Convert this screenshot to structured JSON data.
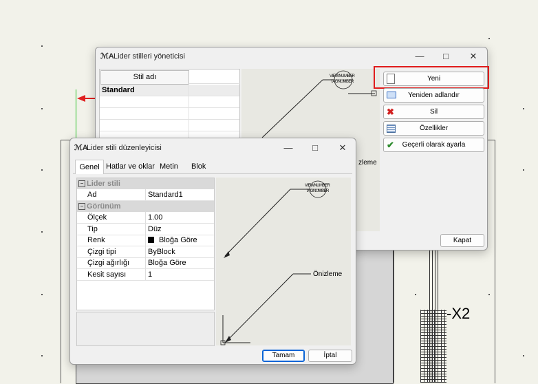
{
  "cad": {
    "label_x2": "-X2",
    "preview_label_top": "VIEWNUMBER\nTAGNUMBER",
    "preview_note_partial": "zleme"
  },
  "manager": {
    "title": "Lider stilleri yöneticisi",
    "table": {
      "column_header": "Stil adı",
      "rows": [
        "Standard"
      ]
    },
    "buttons": {
      "new": "Yeni",
      "rename": "Yeniden adlandır",
      "delete": "Sil",
      "properties": "Özellikler",
      "set_current": "Geçerli olarak ayarla",
      "close": "Kapat"
    }
  },
  "editor": {
    "title": "Lider stili düzenleyicisi",
    "tabs": [
      "Genel",
      "Hatlar ve oklar",
      "Metin",
      "Blok"
    ],
    "groups": [
      {
        "name": "Lider stili",
        "props": [
          {
            "label": "Ad",
            "value": "Standard1"
          }
        ]
      },
      {
        "name": "Görünüm",
        "props": [
          {
            "label": "Ölçek",
            "value": "1.00"
          },
          {
            "label": "Tip",
            "value": "Düz"
          },
          {
            "label": "Renk",
            "value": "Bloğa Göre"
          },
          {
            "label": "Çizgi tipi",
            "value": "ByBlock"
          },
          {
            "label": "Çizgi ağırlığı",
            "value": "Bloğa Göre"
          },
          {
            "label": "Kesit sayısı",
            "value": "1"
          }
        ]
      }
    ],
    "preview": {
      "tag_text": "VIEWNUMBER\nTAGNUMBER",
      "note": "Önizleme"
    },
    "buttons": {
      "ok": "Tamam",
      "cancel": "İptal"
    }
  },
  "colors": {
    "highlight_red": "#e01b1b",
    "accent_blue": "#0a64d6",
    "delete_red": "#d21f1f",
    "check_green": "#2e8b2e"
  }
}
